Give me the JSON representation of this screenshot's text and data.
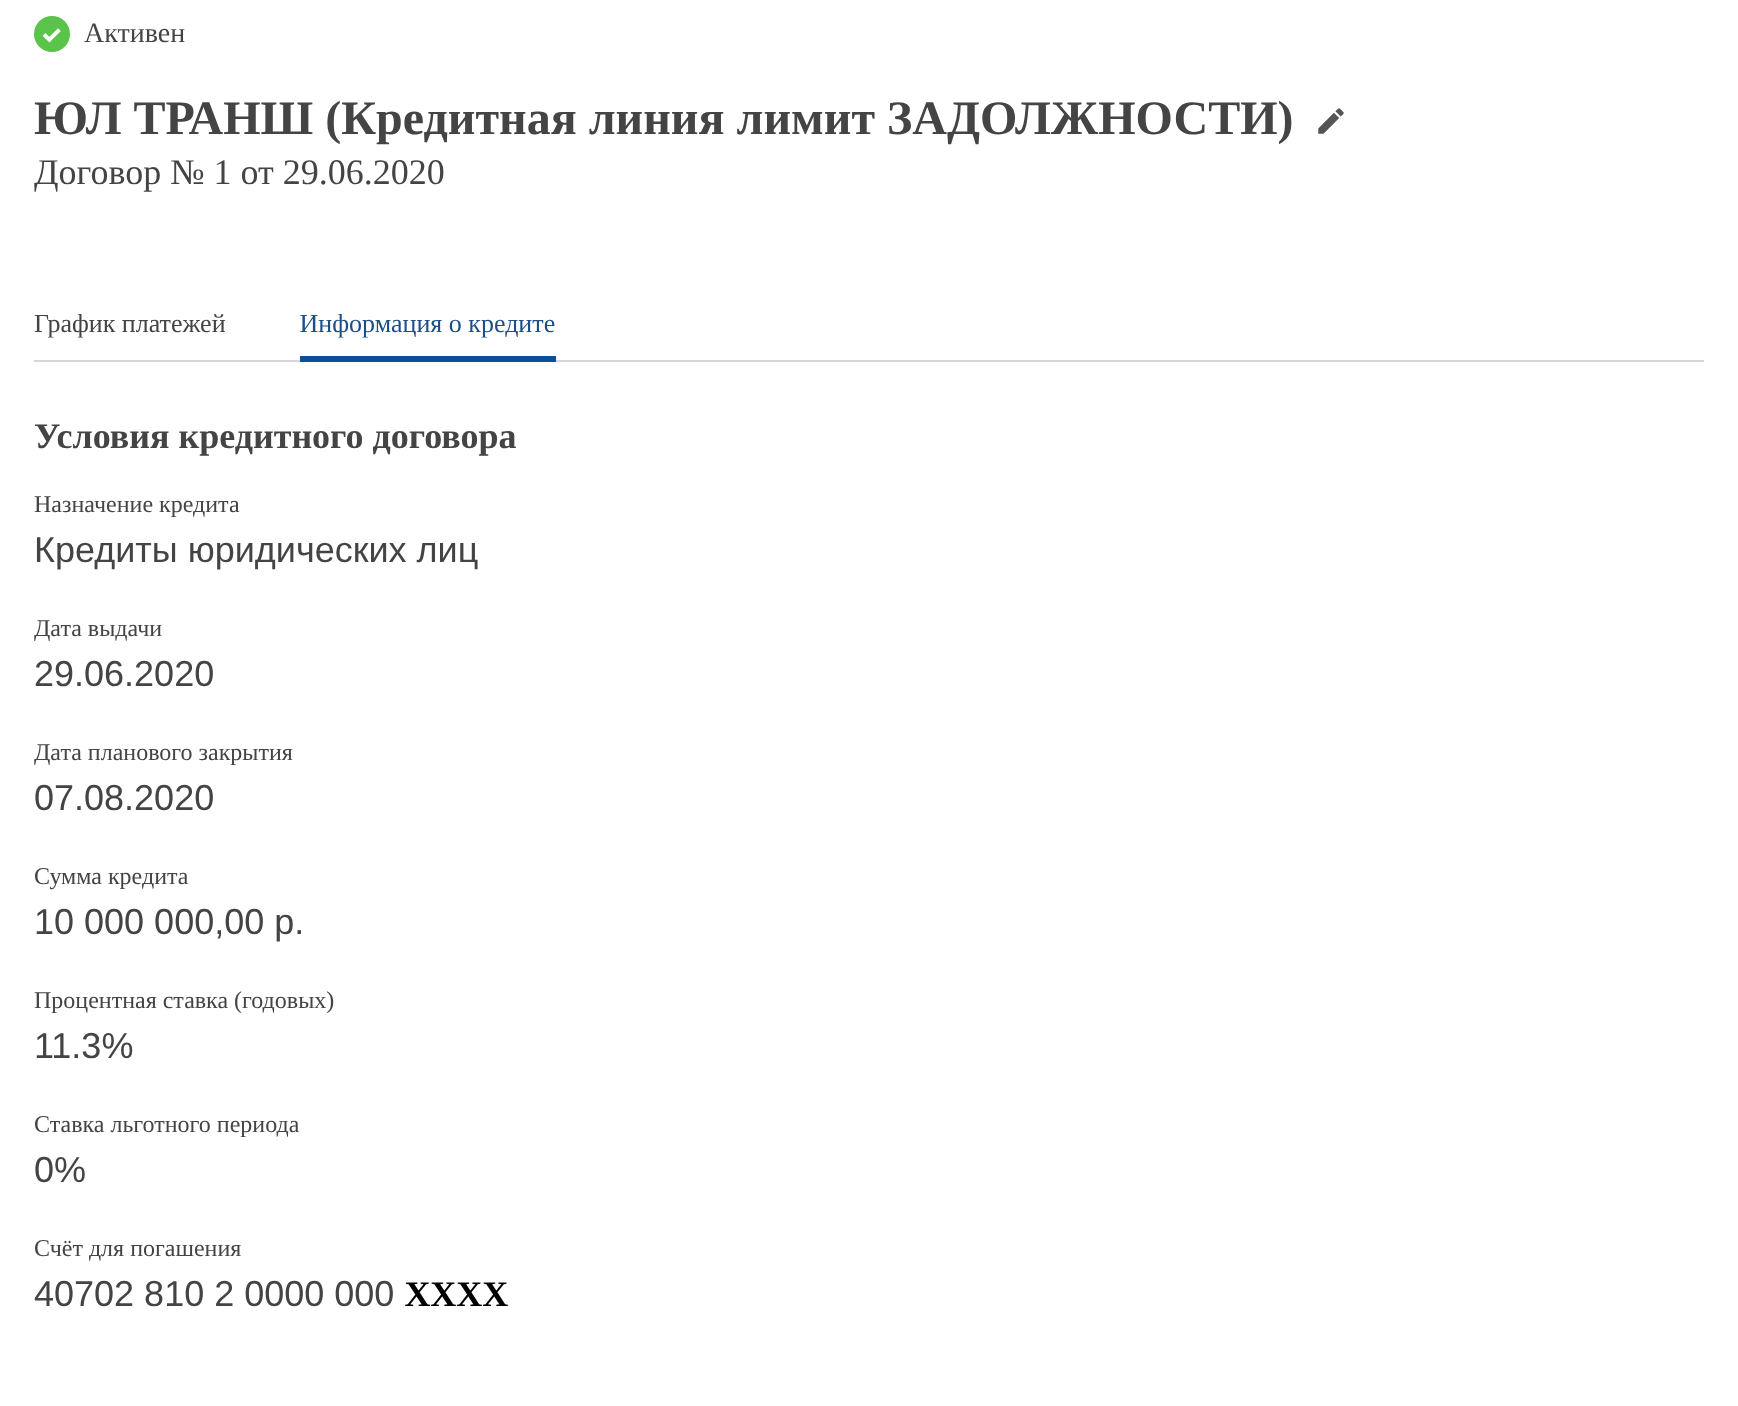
{
  "status": {
    "label": "Активен",
    "active": true
  },
  "title": "ЮЛ ТРАНШ (Кредитная линия лимит ЗАДОЛЖНОСТИ)",
  "subtitle": "Договор № 1 от 29.06.2020",
  "tabs": [
    {
      "label": "График платежей",
      "selected": false
    },
    {
      "label": "Информация о кредите",
      "selected": true
    }
  ],
  "section": {
    "title": "Условия кредитного договора",
    "fields": [
      {
        "label": "Назначение кредита",
        "value": "Кредиты юридических лиц"
      },
      {
        "label": "Дата выдачи",
        "value": "29.06.2020"
      },
      {
        "label": "Дата планового закрытия",
        "value": "07.08.2020"
      },
      {
        "label": "Сумма кредита",
        "value": "10 000 000,00 р."
      },
      {
        "label": "Процентная ставка (годовых)",
        "value": "11.3%"
      },
      {
        "label": "Ставка льготного периода",
        "value": "0%"
      },
      {
        "label": "Счёт для погашения",
        "value": "40702 810 2 0000 000 **XXXX**"
      }
    ]
  }
}
